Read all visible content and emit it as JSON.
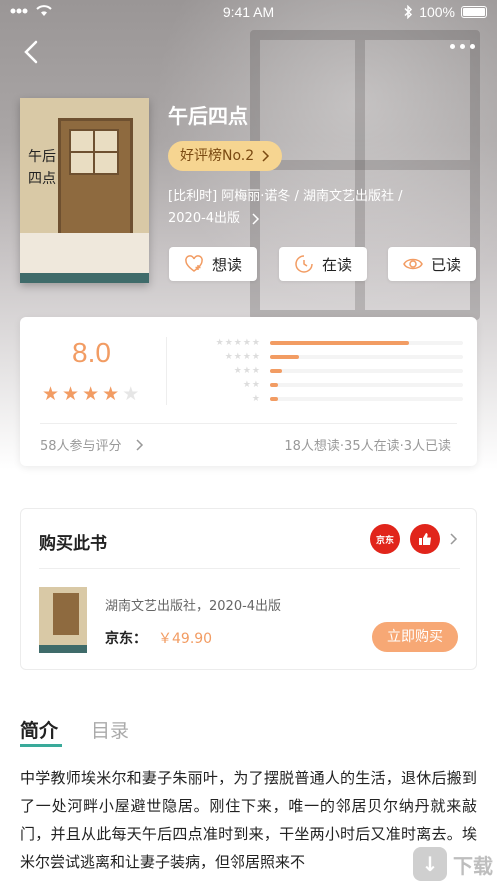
{
  "status_bar": {
    "time": "9:41 AM",
    "battery": "100%"
  },
  "book": {
    "title": "午后四点",
    "cover_title": "午后四点",
    "rank_badge": "好评榜No.2",
    "meta_line1": "[比利时] 阿梅丽·诺冬 / 湖南文艺出版社 /",
    "meta_line2": "2020-4出版"
  },
  "actions": [
    {
      "label": "想读",
      "icon": "heart-plus-icon"
    },
    {
      "label": "在读",
      "icon": "clock-icon"
    },
    {
      "label": "已读",
      "icon": "eye-check-icon"
    }
  ],
  "rating": {
    "score": "8.0",
    "stars_filled": 4,
    "stars_total": 5,
    "distribution": [
      0.72,
      0.15,
      0.06,
      0.04,
      0.04
    ],
    "count_label": "58人参与评分",
    "stats_label": "18人想读·35人在读·3人已读"
  },
  "buy": {
    "title": "购买此书",
    "shops": [
      "京东",
      "like"
    ],
    "publisher_line": "湖南文艺出版社，2020-4出版",
    "store": "京东：",
    "price": "￥49.90",
    "buy_button": "立即购买"
  },
  "tabs": [
    {
      "label": "简介",
      "active": true
    },
    {
      "label": "目录",
      "active": false
    }
  ],
  "intro": "中学教师埃米尔和妻子朱丽叶，为了摆脱普通人的生活，退休后搬到了一处河畔小屋避世隐居。刚住下来，唯一的邻居贝尔纳丹就来敲门，并且从此每天午后四点准时到来，干坐两小时后又准时离去。埃米尔尝试逃离和让妻子装病，但邻居照来不",
  "watermark": "下载",
  "colors": {
    "accent": "#f29c63",
    "tab_underline": "#3aaa9a",
    "badge": "#f6d591"
  }
}
